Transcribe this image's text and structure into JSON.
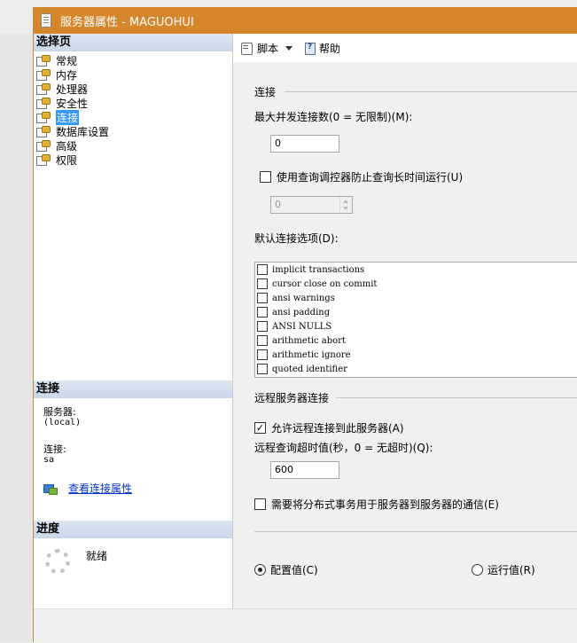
{
  "window": {
    "title": "服务器属性 - MAGUOHUI"
  },
  "left": {
    "select_page_header": "选择页",
    "pages": [
      {
        "label": "常规",
        "icon": "page-settings-icon"
      },
      {
        "label": "内存",
        "icon": "page-settings-icon"
      },
      {
        "label": "处理器",
        "icon": "page-settings-icon"
      },
      {
        "label": "安全性",
        "icon": "page-settings-icon"
      },
      {
        "label": "连接",
        "icon": "page-settings-icon",
        "selected": true
      },
      {
        "label": "数据库设置",
        "icon": "page-settings-icon"
      },
      {
        "label": "高级",
        "icon": "page-settings-icon"
      },
      {
        "label": "权限",
        "icon": "page-settings-icon"
      }
    ],
    "connection_header": "连接",
    "server_label": "服务器:",
    "server_value": "(local)",
    "connection_label": "连接:",
    "connection_value": "sa",
    "view_conn_props": "查看连接属性",
    "progress_header": "进度",
    "status": "就绪"
  },
  "toolbar": {
    "script_label": "脚本",
    "help_label": "帮助"
  },
  "connections": {
    "group_title": "连接",
    "max_conn_label": "最大并发连接数(0 = 无限制)(M):",
    "max_conn_value": "0",
    "query_governor_label": "使用查询调控器防止查询长时间运行(U)",
    "query_governor_checked": false,
    "query_governor_value": "0",
    "default_options_label": "默认连接选项(D):",
    "default_options": [
      {
        "label": "implicit transactions",
        "checked": false
      },
      {
        "label": "cursor close on commit",
        "checked": false
      },
      {
        "label": "ansi warnings",
        "checked": false
      },
      {
        "label": "ansi padding",
        "checked": false
      },
      {
        "label": "ANSI NULLS",
        "checked": false
      },
      {
        "label": "arithmetic abort",
        "checked": false
      },
      {
        "label": "arithmetic ignore",
        "checked": false
      },
      {
        "label": "quoted identifier",
        "checked": false
      }
    ]
  },
  "remote": {
    "group_title": "远程服务器连接",
    "allow_remote_label": "允许远程连接到此服务器(A)",
    "allow_remote_checked": true,
    "timeout_label": "远程查询超时值(秒，0 = 无超时)(Q):",
    "timeout_value": "600",
    "distributed_tx_label": "需要将分布式事务用于服务器到服务器的通信(E)",
    "distributed_tx_checked": false
  },
  "view_mode": {
    "configured_label": "配置值(C)",
    "running_label": "运行值(R)",
    "selected": "configured"
  }
}
